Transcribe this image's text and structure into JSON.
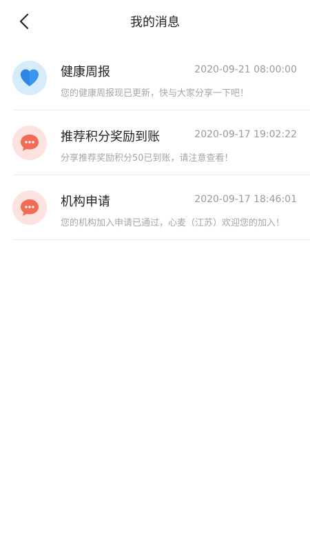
{
  "header": {
    "title": "我的消息"
  },
  "colors": {
    "accent_blue": "#3a95f0",
    "accent_red": "#f26b55",
    "divider": "#ececec"
  },
  "messages": [
    {
      "icon": "heart-icon",
      "title": "健康周报",
      "time": "2020-09-21 08:00:00",
      "snippet": "您的健康周报现已更新，快与大家分享一下吧！"
    },
    {
      "icon": "chat-bubble-icon",
      "title": "推荐积分奖励到账",
      "time": "2020-09-17 19:02:22",
      "snippet": "分享推荐奖励积分50已到账，请注意查看！"
    },
    {
      "icon": "chat-bubble-icon",
      "title": "机构申请",
      "time": "2020-09-17 18:46:01",
      "snippet": "您的机构加入申请已通过，心麦（江苏）欢迎您的加入！"
    }
  ]
}
